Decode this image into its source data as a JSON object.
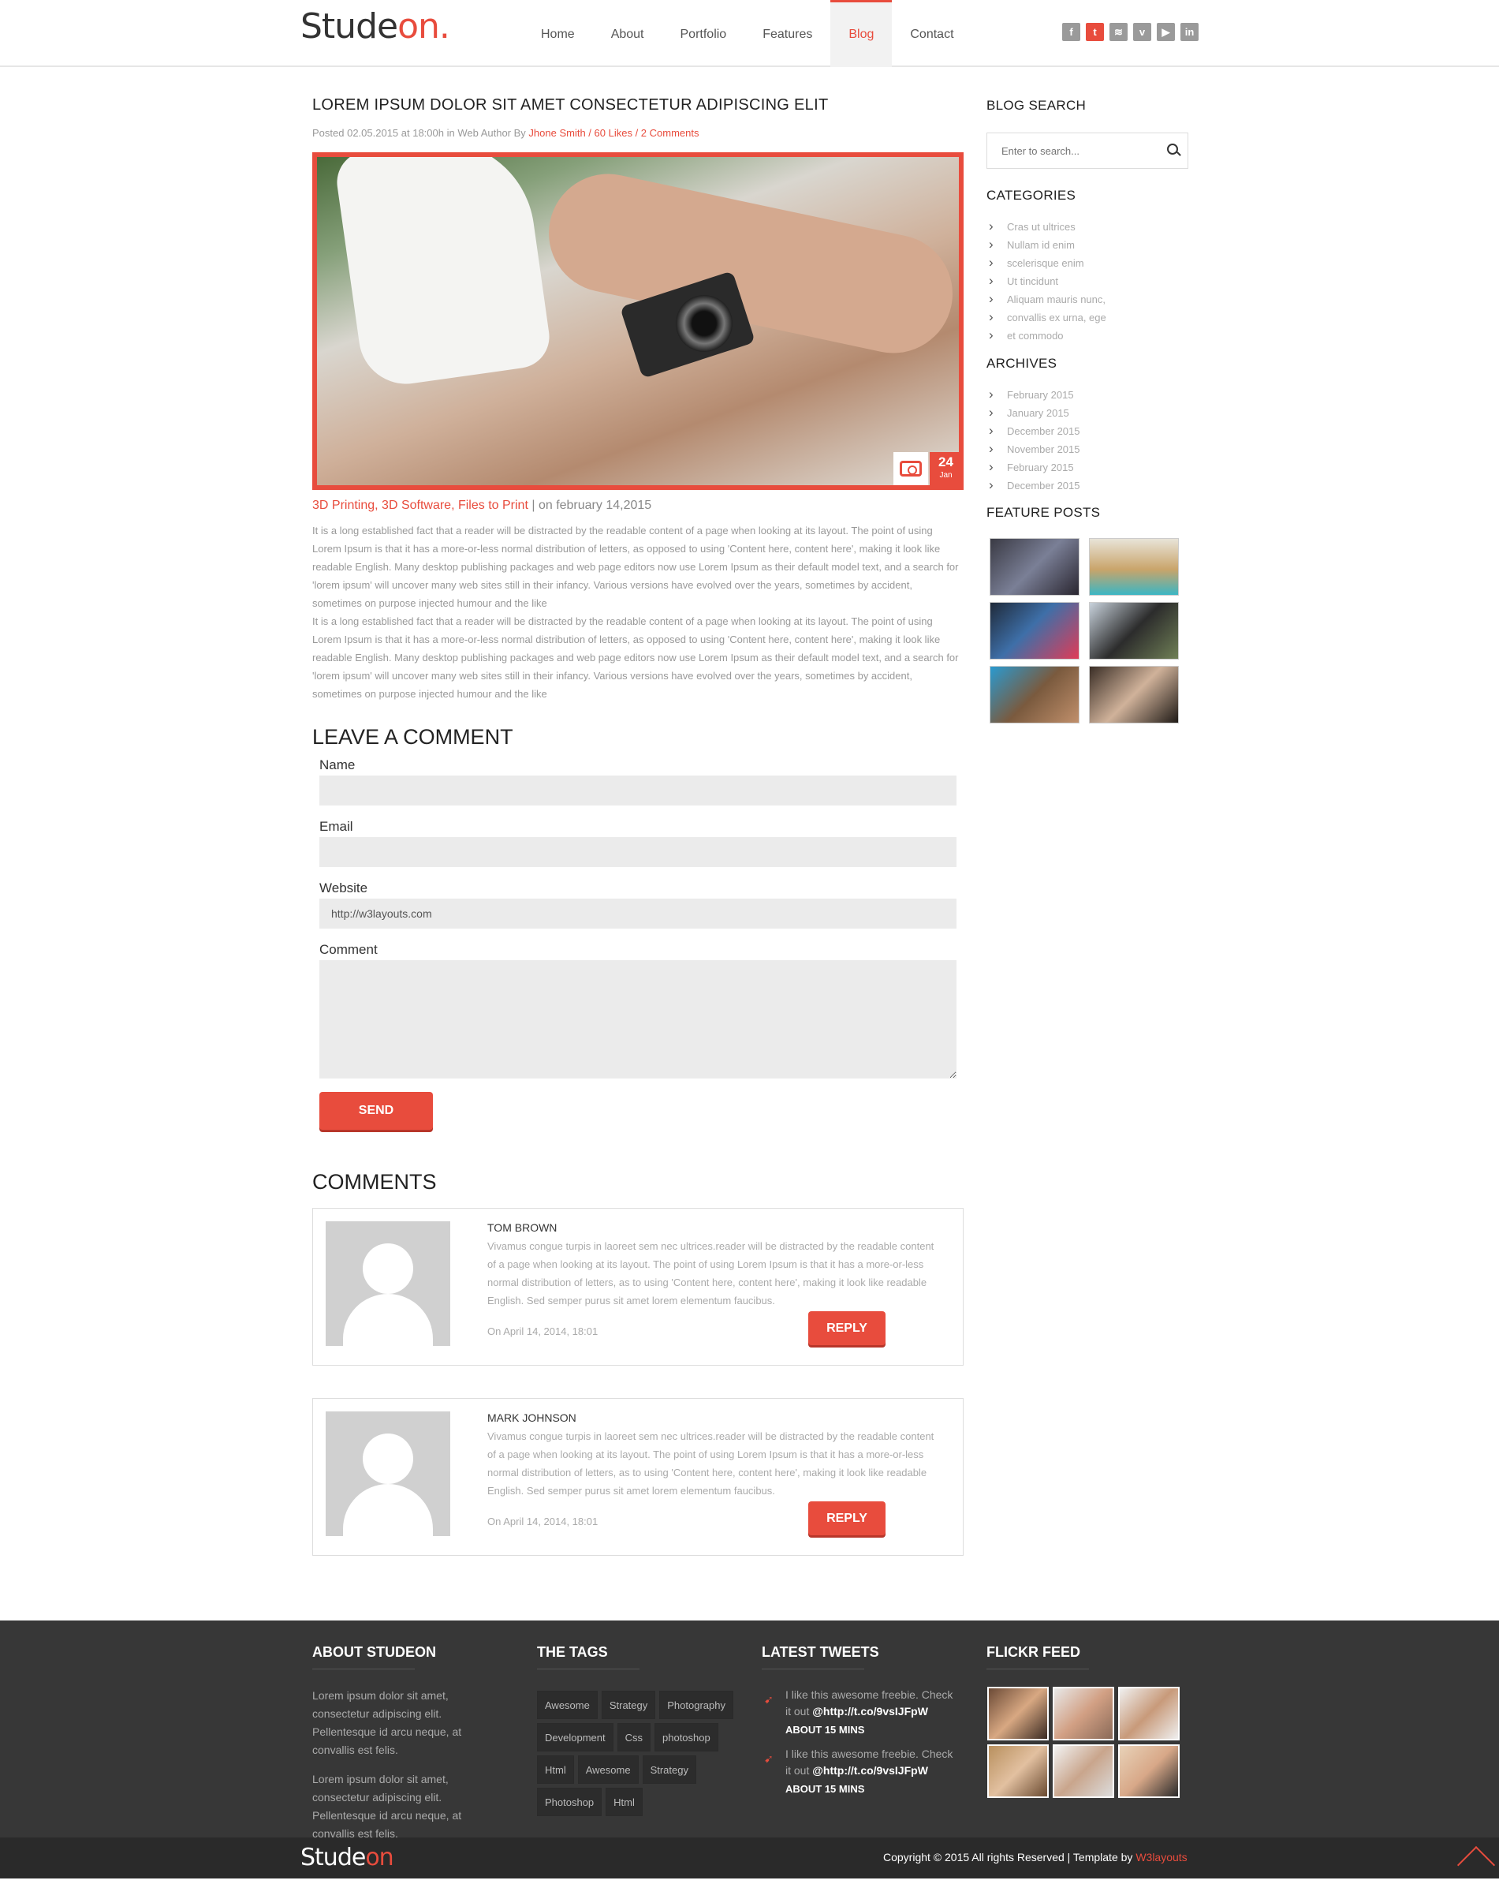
{
  "brand": {
    "logo_main": "Stude",
    "logo_accent": "on.",
    "footer_logo_main": "Stude",
    "footer_logo_accent": "on"
  },
  "nav": {
    "items": [
      "Home",
      "About",
      "Portfolio",
      "Features",
      "Blog",
      "Contact"
    ],
    "active": "Blog"
  },
  "social": [
    "facebook-icon",
    "twitter-icon",
    "rss-icon",
    "vimeo-icon",
    "youtube-icon",
    "linkedin-icon"
  ],
  "post": {
    "title": "LOREM IPSUM DOLOR SIT AMET CONSECTETUR ADIPISCING ELIT",
    "meta_prefix": "Posted 02.05.2015 at 18:00h in Web Author By",
    "author": "Jhone Smith",
    "likes": "60 Likes",
    "comments": "2 Comments",
    "badge_day": "24",
    "badge_month": "Jan",
    "categories": "3D Printing, 3D Software, Files to Print",
    "date": "| on february 14,2015",
    "paragraphs": [
      "It is a long established fact that a reader will be distracted by the readable content of a page when looking at its layout. The point of using Lorem Ipsum is that it has a more-or-less normal distribution of letters, as opposed to using 'Content here, content here', making it look like readable English. Many desktop publishing packages and web page editors now use Lorem Ipsum as their default model text, and a search for 'lorem ipsum' will uncover many web sites still in their infancy. Various versions have evolved over the years, sometimes by accident, sometimes on purpose injected humour and the like",
      "It is a long established fact that a reader will be distracted by the readable content of a page when looking at its layout. The point of using Lorem Ipsum is that it has a more-or-less normal distribution of letters, as opposed to using 'Content here, content here', making it look like readable English. Many desktop publishing packages and web page editors now use Lorem Ipsum as their default model text, and a search for 'lorem ipsum' will uncover many web sites still in their infancy. Various versions have evolved over the years, sometimes by accident, sometimes on purpose injected humour and the like"
    ]
  },
  "comment_form": {
    "heading": "LEAVE A COMMENT",
    "name_label": "Name",
    "email_label": "Email",
    "website_label": "Website",
    "website_value": "http://w3layouts.com",
    "comment_label": "Comment",
    "send_label": "SEND"
  },
  "comments": {
    "heading": "COMMENTS",
    "items": [
      {
        "name": "TOM BROWN",
        "text": "Vivamus congue turpis in laoreet sem nec ultrices.reader will be distracted by the readable content of a page when looking at its layout. The point of using Lorem Ipsum is that it has a more-or-less normal distribution of letters, as to using 'Content here, content here', making it look like readable English. Sed semper purus sit amet lorem elementum faucibus.",
        "date": "On April 14, 2014, 18:01",
        "reply": "REPLY"
      },
      {
        "name": "MARK JOHNSON",
        "text": "Vivamus congue turpis in laoreet sem nec ultrices.reader will be distracted by the readable content of a page when looking at its layout. The point of using Lorem Ipsum is that it has a more-or-less normal distribution of letters, as to using 'Content here, content here', making it look like readable English. Sed semper purus sit amet lorem elementum faucibus.",
        "date": "On April 14, 2014, 18:01",
        "reply": "REPLY"
      }
    ]
  },
  "sidebar": {
    "search_heading": "BLOG SEARCH",
    "search_placeholder": "Enter to search...",
    "categories_heading": "CATEGORIES",
    "categories": [
      "Cras ut ultrices",
      "Nullam id enim",
      "scelerisque enim",
      "Ut tincidunt",
      "Aliquam mauris nunc,",
      "convallis ex urna, ege",
      "et commodo"
    ],
    "archives_heading": "ARCHIVES",
    "archives": [
      "February 2015",
      "January 2015",
      "December 2015",
      "November 2015",
      "February 2015",
      "December 2015"
    ],
    "feature_heading": "FEATURE POSTS"
  },
  "footer": {
    "about_heading": "ABOUT STUDEON",
    "about_paragraphs": [
      "Lorem ipsum dolor sit amet, consectetur adipiscing elit. Pellentesque id arcu neque, at convallis est felis.",
      "Lorem ipsum dolor sit amet, consectetur adipiscing elit. Pellentesque id arcu neque, at convallis est felis."
    ],
    "tags_heading": "THE TAGS",
    "tags": [
      "Awesome",
      "Strategy",
      "Photography",
      "Development",
      "Css",
      "photoshop",
      "Html",
      "Awesome",
      "Strategy",
      "Photoshop",
      "Html"
    ],
    "tweets_heading": "LATEST TWEETS",
    "tweets": [
      {
        "text": "I like this awesome freebie. Check it out",
        "link": "@http://t.co/9vsIJFpW",
        "ago": "ABOUT 15 MINS"
      },
      {
        "text": "I like this awesome freebie. Check it out",
        "link": "@http://t.co/9vsIJFpW",
        "ago": "ABOUT 15 MINS"
      }
    ],
    "flickr_heading": "FLICKR FEED",
    "copyright": "Copyright © 2015 All rights Reserved | Template by",
    "template_by": "W3layouts"
  },
  "colors": {
    "accent": "#e84c3d",
    "footer_bg": "#373737",
    "bottom_bg": "#2a2a2a"
  }
}
